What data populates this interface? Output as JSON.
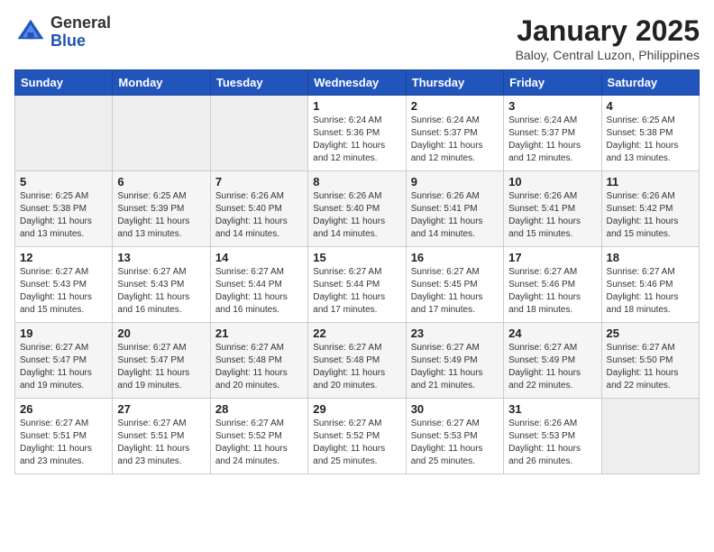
{
  "header": {
    "logo_general": "General",
    "logo_blue": "Blue",
    "month_title": "January 2025",
    "location": "Baloy, Central Luzon, Philippines"
  },
  "weekdays": [
    "Sunday",
    "Monday",
    "Tuesday",
    "Wednesday",
    "Thursday",
    "Friday",
    "Saturday"
  ],
  "weeks": [
    [
      {
        "day": "",
        "info": ""
      },
      {
        "day": "",
        "info": ""
      },
      {
        "day": "",
        "info": ""
      },
      {
        "day": "1",
        "info": "Sunrise: 6:24 AM\nSunset: 5:36 PM\nDaylight: 11 hours\nand 12 minutes."
      },
      {
        "day": "2",
        "info": "Sunrise: 6:24 AM\nSunset: 5:37 PM\nDaylight: 11 hours\nand 12 minutes."
      },
      {
        "day": "3",
        "info": "Sunrise: 6:24 AM\nSunset: 5:37 PM\nDaylight: 11 hours\nand 12 minutes."
      },
      {
        "day": "4",
        "info": "Sunrise: 6:25 AM\nSunset: 5:38 PM\nDaylight: 11 hours\nand 13 minutes."
      }
    ],
    [
      {
        "day": "5",
        "info": "Sunrise: 6:25 AM\nSunset: 5:38 PM\nDaylight: 11 hours\nand 13 minutes."
      },
      {
        "day": "6",
        "info": "Sunrise: 6:25 AM\nSunset: 5:39 PM\nDaylight: 11 hours\nand 13 minutes."
      },
      {
        "day": "7",
        "info": "Sunrise: 6:26 AM\nSunset: 5:40 PM\nDaylight: 11 hours\nand 14 minutes."
      },
      {
        "day": "8",
        "info": "Sunrise: 6:26 AM\nSunset: 5:40 PM\nDaylight: 11 hours\nand 14 minutes."
      },
      {
        "day": "9",
        "info": "Sunrise: 6:26 AM\nSunset: 5:41 PM\nDaylight: 11 hours\nand 14 minutes."
      },
      {
        "day": "10",
        "info": "Sunrise: 6:26 AM\nSunset: 5:41 PM\nDaylight: 11 hours\nand 15 minutes."
      },
      {
        "day": "11",
        "info": "Sunrise: 6:26 AM\nSunset: 5:42 PM\nDaylight: 11 hours\nand 15 minutes."
      }
    ],
    [
      {
        "day": "12",
        "info": "Sunrise: 6:27 AM\nSunset: 5:43 PM\nDaylight: 11 hours\nand 15 minutes."
      },
      {
        "day": "13",
        "info": "Sunrise: 6:27 AM\nSunset: 5:43 PM\nDaylight: 11 hours\nand 16 minutes."
      },
      {
        "day": "14",
        "info": "Sunrise: 6:27 AM\nSunset: 5:44 PM\nDaylight: 11 hours\nand 16 minutes."
      },
      {
        "day": "15",
        "info": "Sunrise: 6:27 AM\nSunset: 5:44 PM\nDaylight: 11 hours\nand 17 minutes."
      },
      {
        "day": "16",
        "info": "Sunrise: 6:27 AM\nSunset: 5:45 PM\nDaylight: 11 hours\nand 17 minutes."
      },
      {
        "day": "17",
        "info": "Sunrise: 6:27 AM\nSunset: 5:46 PM\nDaylight: 11 hours\nand 18 minutes."
      },
      {
        "day": "18",
        "info": "Sunrise: 6:27 AM\nSunset: 5:46 PM\nDaylight: 11 hours\nand 18 minutes."
      }
    ],
    [
      {
        "day": "19",
        "info": "Sunrise: 6:27 AM\nSunset: 5:47 PM\nDaylight: 11 hours\nand 19 minutes."
      },
      {
        "day": "20",
        "info": "Sunrise: 6:27 AM\nSunset: 5:47 PM\nDaylight: 11 hours\nand 19 minutes."
      },
      {
        "day": "21",
        "info": "Sunrise: 6:27 AM\nSunset: 5:48 PM\nDaylight: 11 hours\nand 20 minutes."
      },
      {
        "day": "22",
        "info": "Sunrise: 6:27 AM\nSunset: 5:48 PM\nDaylight: 11 hours\nand 20 minutes."
      },
      {
        "day": "23",
        "info": "Sunrise: 6:27 AM\nSunset: 5:49 PM\nDaylight: 11 hours\nand 21 minutes."
      },
      {
        "day": "24",
        "info": "Sunrise: 6:27 AM\nSunset: 5:49 PM\nDaylight: 11 hours\nand 22 minutes."
      },
      {
        "day": "25",
        "info": "Sunrise: 6:27 AM\nSunset: 5:50 PM\nDaylight: 11 hours\nand 22 minutes."
      }
    ],
    [
      {
        "day": "26",
        "info": "Sunrise: 6:27 AM\nSunset: 5:51 PM\nDaylight: 11 hours\nand 23 minutes."
      },
      {
        "day": "27",
        "info": "Sunrise: 6:27 AM\nSunset: 5:51 PM\nDaylight: 11 hours\nand 23 minutes."
      },
      {
        "day": "28",
        "info": "Sunrise: 6:27 AM\nSunset: 5:52 PM\nDaylight: 11 hours\nand 24 minutes."
      },
      {
        "day": "29",
        "info": "Sunrise: 6:27 AM\nSunset: 5:52 PM\nDaylight: 11 hours\nand 25 minutes."
      },
      {
        "day": "30",
        "info": "Sunrise: 6:27 AM\nSunset: 5:53 PM\nDaylight: 11 hours\nand 25 minutes."
      },
      {
        "day": "31",
        "info": "Sunrise: 6:26 AM\nSunset: 5:53 PM\nDaylight: 11 hours\nand 26 minutes."
      },
      {
        "day": "",
        "info": ""
      }
    ]
  ]
}
